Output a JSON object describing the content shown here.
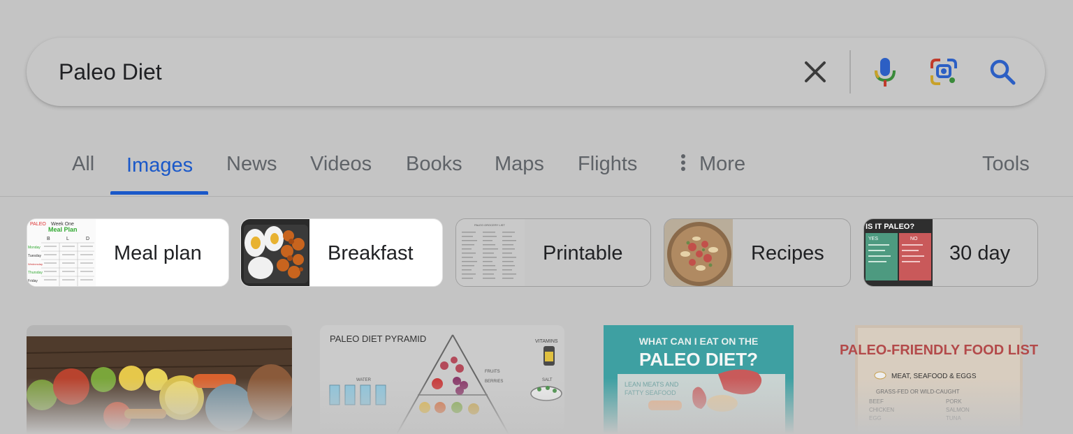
{
  "search": {
    "value": "Paleo Diet"
  },
  "icons": {
    "clear": "close-icon",
    "mic": "mic-icon",
    "lens": "camera-lens-icon",
    "search": "search-icon",
    "more": "vertical-dots-icon"
  },
  "tabs": [
    {
      "label": "All",
      "active": false
    },
    {
      "label": "Images",
      "active": true
    },
    {
      "label": "News",
      "active": false
    },
    {
      "label": "Videos",
      "active": false
    },
    {
      "label": "Books",
      "active": false
    },
    {
      "label": "Maps",
      "active": false
    },
    {
      "label": "Flights",
      "active": false
    },
    {
      "label": "More",
      "active": false
    }
  ],
  "tools_label": "Tools",
  "chips": [
    {
      "label": "Meal plan",
      "thumb_text": [
        "PALEO",
        "Week One",
        "Meal Plan",
        "B",
        "L",
        "D",
        "Monday",
        "Tuesday",
        "Wednesday",
        "Thursday",
        "Friday"
      ]
    },
    {
      "label": "Breakfast"
    },
    {
      "label": "Printable",
      "thumb_text": [
        "PALEO GROCERY LIST"
      ]
    },
    {
      "label": "Recipes"
    },
    {
      "label": "30 day",
      "thumb_text": [
        "IS IT PALEO?",
        "YES",
        "NO"
      ]
    }
  ],
  "results": [
    {
      "alt": "fruits and vegetables photo"
    },
    {
      "title": "PALEO DIET PYRAMID",
      "labels": [
        "VITAMINS",
        "WATER",
        "FRUITS",
        "BERRIES",
        "SALT"
      ]
    },
    {
      "title_line1": "WHAT CAN I EAT ON THE",
      "title_line2": "PALEO DIET?",
      "subtitle": "LEAN MEATS AND",
      "subtitle2": "FATTY SEAFOOD"
    },
    {
      "title": "PALEO-FRIENDLY FOOD LIST",
      "section": "MEAT, SEAFOOD & EGGS",
      "sub": "GRASS-FED OR WILD-CAUGHT",
      "col1": [
        "BEEF",
        "CHICKEN",
        "EGG"
      ],
      "col2": [
        "PORK",
        "SALMON",
        "TUNA"
      ]
    }
  ],
  "colors": {
    "accent": "#1a58c9",
    "background": "#c4c4c4",
    "text": "#202124",
    "muted": "#5f6368"
  }
}
